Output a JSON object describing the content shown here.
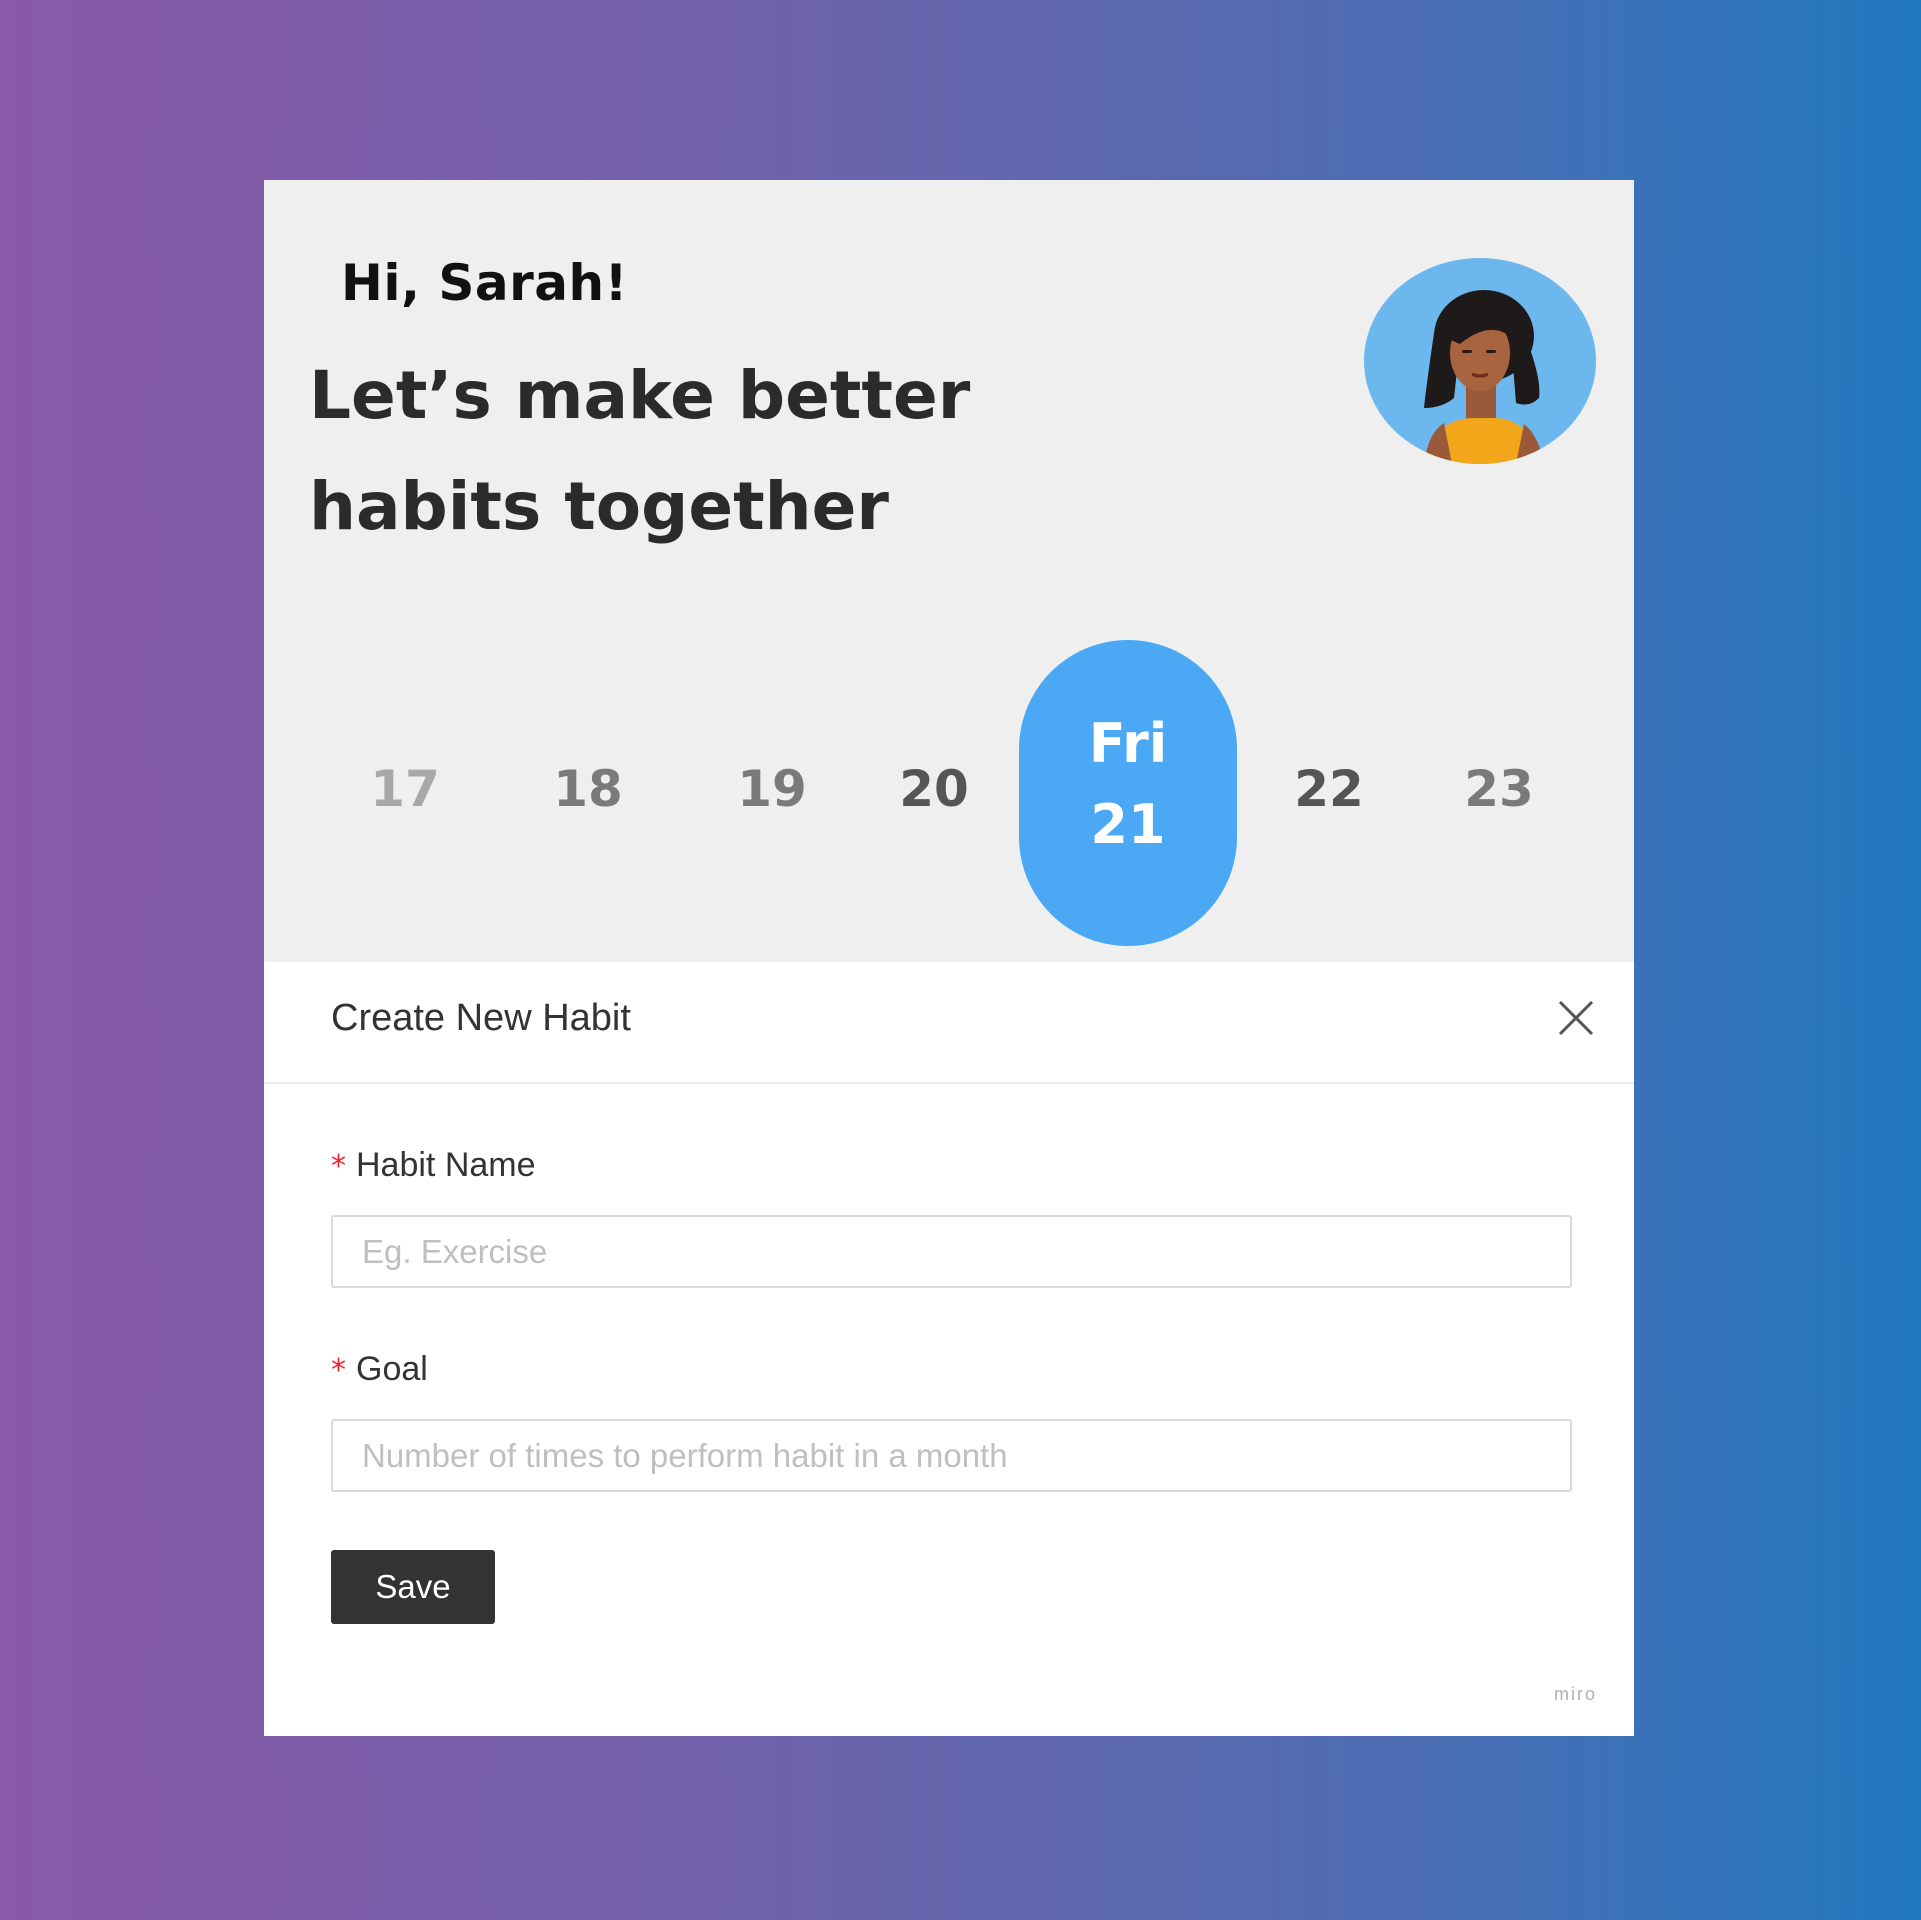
{
  "greeting": "Hi, Sarah!",
  "headline": "Let’s make better habits together",
  "calendar": {
    "days": [
      "17",
      "18",
      "19",
      "20",
      "22",
      "23"
    ],
    "selected": {
      "weekday": "Fri",
      "date": "21"
    }
  },
  "modal": {
    "title": "Create New Habit",
    "close_icon": "close-icon",
    "fields": [
      {
        "label": "Habit Name",
        "required_mark": "*",
        "placeholder": "Eg. Exercise",
        "value": ""
      },
      {
        "label": "Goal",
        "required_mark": "*",
        "placeholder": "Number of times to perform habit in a month",
        "value": ""
      }
    ],
    "save_label": "Save"
  },
  "watermark": "miro",
  "colors": {
    "accent": "#4aa8f5",
    "button": "#333333",
    "required": "#f5222d",
    "hero_background": "#efefef"
  }
}
